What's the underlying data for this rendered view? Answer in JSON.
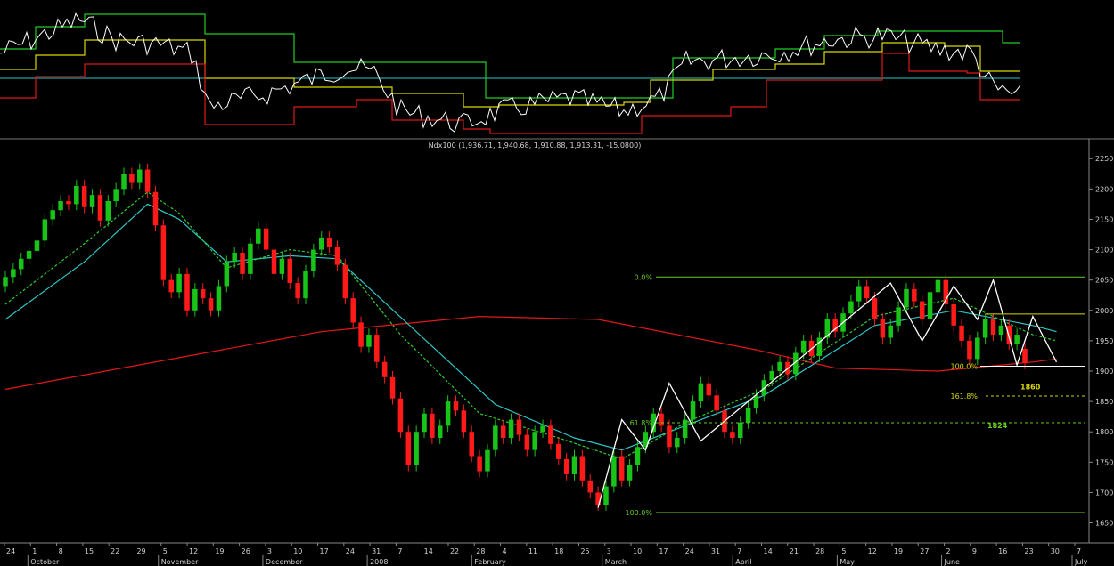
{
  "chart_data": {
    "type": "candlestick",
    "title": "Ndx100 (1,936.71, 1,940.68, 1,910.88, 1,913.31, -15.0800)",
    "colors": {
      "background": "#000000",
      "up_candle": "#19c419",
      "down_candle": "#ff1a1a",
      "ma_long": "#e01818",
      "ma_mid": "#2ec4c4",
      "ma_short": "#2ecc2e",
      "pattern_lines": "#ffffff",
      "fib_retracement": "#66cc22",
      "fib_extension": "#d8d800"
    },
    "y_axis": {
      "ylim": [
        1620,
        2265
      ],
      "ticks": [
        2250,
        2200,
        2150,
        2100,
        2050,
        2000,
        1950,
        1900,
        1850,
        1800,
        1750,
        1700,
        1650
      ]
    },
    "x_axis": {
      "day_ticks": [
        "24",
        "1",
        "8",
        "15",
        "22",
        "29",
        "5",
        "12",
        "19",
        "26",
        "3",
        "10",
        "17",
        "24",
        "31",
        "7",
        "14",
        "22",
        "28",
        "4",
        "11",
        "18",
        "25",
        "3",
        "10",
        "17",
        "24",
        "31",
        "7",
        "14",
        "21",
        "28",
        "5",
        "12",
        "19",
        "27",
        "2",
        "9",
        "16",
        "23",
        "30",
        "7"
      ],
      "month_labels": [
        "October",
        "November",
        "December",
        "2008",
        "February",
        "March",
        "April",
        "May",
        "June",
        "July"
      ]
    },
    "price_series": [
      {
        "o": 2040,
        "c": 2055
      },
      {
        "o": 2055,
        "c": 2068
      },
      {
        "o": 2068,
        "c": 2085
      },
      {
        "o": 2085,
        "c": 2098
      },
      {
        "o": 2098,
        "c": 2115
      },
      {
        "o": 2115,
        "c": 2150
      },
      {
        "o": 2150,
        "c": 2165
      },
      {
        "o": 2165,
        "c": 2180
      },
      {
        "o": 2180,
        "c": 2175
      },
      {
        "o": 2175,
        "c": 2205
      },
      {
        "o": 2205,
        "c": 2170
      },
      {
        "o": 2170,
        "c": 2190
      },
      {
        "o": 2190,
        "c": 2148
      },
      {
        "o": 2148,
        "c": 2180
      },
      {
        "o": 2180,
        "c": 2200
      },
      {
        "o": 2200,
        "c": 2225
      },
      {
        "o": 2225,
        "c": 2210
      },
      {
        "o": 2210,
        "c": 2232
      },
      {
        "o": 2232,
        "c": 2195
      },
      {
        "o": 2195,
        "c": 2140
      },
      {
        "o": 2140,
        "c": 2050
      },
      {
        "o": 2050,
        "c": 2030
      },
      {
        "o": 2030,
        "c": 2060
      },
      {
        "o": 2060,
        "c": 2000
      },
      {
        "o": 2000,
        "c": 2035
      },
      {
        "o": 2035,
        "c": 2020
      },
      {
        "o": 2020,
        "c": 2000
      },
      {
        "o": 2000,
        "c": 2040
      },
      {
        "o": 2040,
        "c": 2080
      },
      {
        "o": 2080,
        "c": 2095
      },
      {
        "o": 2095,
        "c": 2060
      },
      {
        "o": 2060,
        "c": 2110
      },
      {
        "o": 2110,
        "c": 2135
      },
      {
        "o": 2135,
        "c": 2100
      },
      {
        "o": 2100,
        "c": 2060
      },
      {
        "o": 2060,
        "c": 2085
      },
      {
        "o": 2085,
        "c": 2045
      },
      {
        "o": 2045,
        "c": 2020
      },
      {
        "o": 2020,
        "c": 2065
      },
      {
        "o": 2065,
        "c": 2100
      },
      {
        "o": 2100,
        "c": 2120
      },
      {
        "o": 2120,
        "c": 2105
      },
      {
        "o": 2105,
        "c": 2075
      },
      {
        "o": 2075,
        "c": 2020
      },
      {
        "o": 2020,
        "c": 1980
      },
      {
        "o": 1980,
        "c": 1940
      },
      {
        "o": 1940,
        "c": 1960
      },
      {
        "o": 1960,
        "c": 1915
      },
      {
        "o": 1915,
        "c": 1890
      },
      {
        "o": 1890,
        "c": 1855
      },
      {
        "o": 1855,
        "c": 1800
      },
      {
        "o": 1800,
        "c": 1745
      },
      {
        "o": 1745,
        "c": 1800
      },
      {
        "o": 1800,
        "c": 1830
      },
      {
        "o": 1830,
        "c": 1790
      },
      {
        "o": 1790,
        "c": 1810
      },
      {
        "o": 1810,
        "c": 1850
      },
      {
        "o": 1850,
        "c": 1835
      },
      {
        "o": 1835,
        "c": 1800
      },
      {
        "o": 1800,
        "c": 1760
      },
      {
        "o": 1760,
        "c": 1735
      },
      {
        "o": 1735,
        "c": 1770
      },
      {
        "o": 1770,
        "c": 1810
      },
      {
        "o": 1810,
        "c": 1790
      },
      {
        "o": 1790,
        "c": 1820
      },
      {
        "o": 1820,
        "c": 1795
      },
      {
        "o": 1795,
        "c": 1770
      },
      {
        "o": 1770,
        "c": 1800
      },
      {
        "o": 1800,
        "c": 1810
      },
      {
        "o": 1810,
        "c": 1780
      },
      {
        "o": 1780,
        "c": 1755
      },
      {
        "o": 1755,
        "c": 1730
      },
      {
        "o": 1730,
        "c": 1760
      },
      {
        "o": 1760,
        "c": 1720
      },
      {
        "o": 1720,
        "c": 1700
      },
      {
        "o": 1700,
        "c": 1680
      },
      {
        "o": 1680,
        "c": 1710
      },
      {
        "o": 1710,
        "c": 1760
      },
      {
        "o": 1760,
        "c": 1720
      },
      {
        "o": 1720,
        "c": 1745
      },
      {
        "o": 1745,
        "c": 1775
      },
      {
        "o": 1775,
        "c": 1800
      },
      {
        "o": 1800,
        "c": 1830
      },
      {
        "o": 1830,
        "c": 1810
      },
      {
        "o": 1810,
        "c": 1775
      },
      {
        "o": 1775,
        "c": 1790
      },
      {
        "o": 1790,
        "c": 1820
      },
      {
        "o": 1820,
        "c": 1850
      },
      {
        "o": 1850,
        "c": 1880
      },
      {
        "o": 1880,
        "c": 1860
      },
      {
        "o": 1860,
        "c": 1835
      },
      {
        "o": 1835,
        "c": 1800
      },
      {
        "o": 1800,
        "c": 1790
      },
      {
        "o": 1790,
        "c": 1815
      },
      {
        "o": 1815,
        "c": 1840
      },
      {
        "o": 1840,
        "c": 1860
      },
      {
        "o": 1860,
        "c": 1885
      },
      {
        "o": 1885,
        "c": 1900
      },
      {
        "o": 1900,
        "c": 1915
      },
      {
        "o": 1915,
        "c": 1895
      },
      {
        "o": 1895,
        "c": 1930
      },
      {
        "o": 1930,
        "c": 1950
      },
      {
        "o": 1950,
        "c": 1925
      },
      {
        "o": 1925,
        "c": 1955
      },
      {
        "o": 1955,
        "c": 1985
      },
      {
        "o": 1985,
        "c": 1965
      },
      {
        "o": 1965,
        "c": 1995
      },
      {
        "o": 1995,
        "c": 2015
      },
      {
        "o": 2015,
        "c": 2040
      },
      {
        "o": 2040,
        "c": 2020
      },
      {
        "o": 2020,
        "c": 1985
      },
      {
        "o": 1985,
        "c": 1955
      },
      {
        "o": 1955,
        "c": 1975
      },
      {
        "o": 1975,
        "c": 2005
      },
      {
        "o": 2005,
        "c": 2035
      },
      {
        "o": 2035,
        "c": 2015
      },
      {
        "o": 2015,
        "c": 1985
      },
      {
        "o": 1985,
        "c": 2030
      },
      {
        "o": 2030,
        "c": 2050
      },
      {
        "o": 2050,
        "c": 2010
      },
      {
        "o": 2010,
        "c": 1975
      },
      {
        "o": 1975,
        "c": 1950
      },
      {
        "o": 1950,
        "c": 1920
      },
      {
        "o": 1920,
        "c": 1955
      },
      {
        "o": 1955,
        "c": 1985
      },
      {
        "o": 1985,
        "c": 1960
      },
      {
        "o": 1960,
        "c": 1975
      },
      {
        "o": 1975,
        "c": 1945
      },
      {
        "o": 1945,
        "c": 1960
      },
      {
        "o": 1936.71,
        "c": 1913.31
      }
    ],
    "moving_averages": [
      {
        "color": "#e01818",
        "style": "solid",
        "points": [
          [
            0,
            1870
          ],
          [
            40,
            1965
          ],
          [
            60,
            1990
          ],
          [
            75,
            1985
          ],
          [
            95,
            1935
          ],
          [
            105,
            1905
          ],
          [
            118,
            1900
          ],
          [
            130,
            1915
          ],
          [
            133,
            1920
          ]
        ]
      },
      {
        "color": "#2ec4c4",
        "style": "solid",
        "points": [
          [
            0,
            1985
          ],
          [
            10,
            2080
          ],
          [
            18,
            2175
          ],
          [
            22,
            2150
          ],
          [
            28,
            2080
          ],
          [
            36,
            2090
          ],
          [
            42,
            2085
          ],
          [
            52,
            1965
          ],
          [
            62,
            1845
          ],
          [
            72,
            1790
          ],
          [
            78,
            1770
          ],
          [
            86,
            1810
          ],
          [
            96,
            1860
          ],
          [
            110,
            1975
          ],
          [
            120,
            2000
          ],
          [
            130,
            1975
          ],
          [
            133,
            1965
          ]
        ]
      },
      {
        "color": "#2ecc2e",
        "style": "dashed",
        "points": [
          [
            0,
            2010
          ],
          [
            10,
            2110
          ],
          [
            18,
            2195
          ],
          [
            22,
            2160
          ],
          [
            28,
            2070
          ],
          [
            36,
            2100
          ],
          [
            42,
            2090
          ],
          [
            50,
            1960
          ],
          [
            60,
            1830
          ],
          [
            70,
            1790
          ],
          [
            78,
            1755
          ],
          [
            86,
            1815
          ],
          [
            96,
            1870
          ],
          [
            110,
            1990
          ],
          [
            120,
            2020
          ],
          [
            130,
            1960
          ],
          [
            133,
            1950
          ]
        ]
      }
    ],
    "pattern_lines": [
      [
        75,
        1675
      ],
      [
        78,
        1820
      ],
      [
        81,
        1770
      ],
      [
        84,
        1880
      ],
      [
        88,
        1785
      ],
      [
        112,
        2045
      ],
      [
        116,
        1950
      ],
      [
        120,
        2040
      ],
      [
        123,
        1985
      ],
      [
        125,
        2050
      ],
      [
        128,
        1910
      ],
      [
        130,
        1990
      ],
      [
        133,
        1915
      ]
    ],
    "fib_retracement": {
      "levels": [
        {
          "label": "0.0%",
          "value": 2055
        },
        {
          "label": "61.8%",
          "value": 1815
        },
        {
          "label": "100.0%",
          "value": 1667
        }
      ]
    },
    "fib_extension": {
      "levels": [
        {
          "label": "100.0%",
          "value": 1908
        },
        {
          "label": "161.8%",
          "value": 1859
        },
        {
          "label": "",
          "value": 1994
        }
      ],
      "annotations": [
        {
          "text": "1860",
          "value": 1860
        },
        {
          "text": "1824",
          "value": 1818
        }
      ]
    },
    "indicator_panel": {
      "colors": {
        "line": "#ffffff",
        "upper_band": "#22cc22",
        "mid_band": "#d8d800",
        "lower_band": "#e01818",
        "reference_line": "#2ec4c4"
      }
    }
  }
}
